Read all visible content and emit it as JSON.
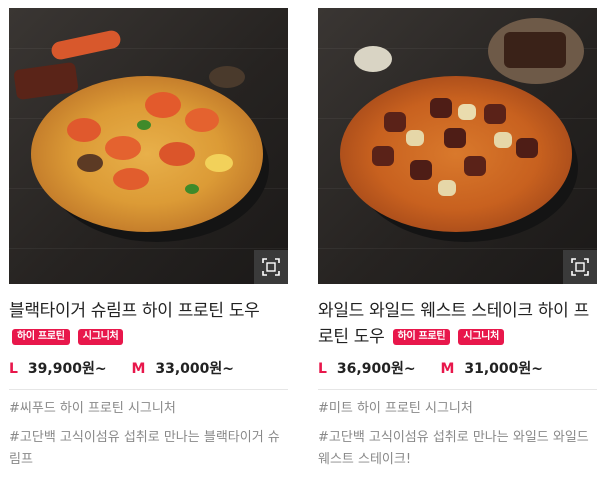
{
  "products": [
    {
      "title": "블랙타이거 슈림프 하이 프로틴 도우",
      "badges": [
        "하이 프로틴",
        "시그니처"
      ],
      "price_l_label": "L",
      "price_l": "39,900원~",
      "price_m_label": "M",
      "price_m": "33,000원~",
      "tags": "#씨푸드 하이 프로틴 시그니처",
      "description": "#고단백 고식이섬유 섭취로 만나는 블랙타이거 슈림프"
    },
    {
      "title": "와일드 와일드 웨스트 스테이크 하이 프로틴 도우",
      "badges": [
        "하이 프로틴",
        "시그니처"
      ],
      "price_l_label": "L",
      "price_l": "36,900원~",
      "price_m_label": "M",
      "price_m": "31,000원~",
      "tags": "#미트 하이 프로틴 시그니처",
      "description": "#고단백 고식이섬유 섭취로 만나는 와일드 와일드 웨스트 스테이크!"
    }
  ],
  "icons": {
    "zoom": "zoom-icon"
  },
  "colors": {
    "accent": "#e8174b",
    "muted_text": "#888888"
  }
}
